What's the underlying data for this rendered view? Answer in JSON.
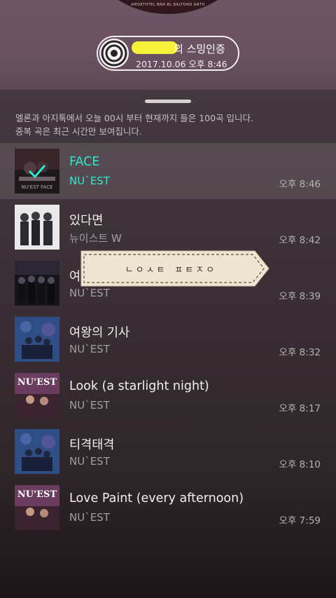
{
  "header": {
    "disc_text": "AMOKTHTEL BNA BL BALTOND ANTH",
    "badge_title": "의 스밍인증",
    "badge_time": "2017.10.06 오후 8:46"
  },
  "panel": {
    "notice_line1": "멜론과 아지톡에서 오늘 00시 부터 현재까지 들은 100곡 입니다.",
    "notice_line2": "중복 곡은 최근 시간만 보여집니다."
  },
  "songs": [
    {
      "title": "FACE",
      "artist": "NU`EST",
      "time": "오후 8:46",
      "active": true,
      "cover_text": "NU'EST FACE"
    },
    {
      "title": "있다면",
      "artist": "뉴이스트 W",
      "time": "오후 8:42",
      "active": false,
      "cover_text": ""
    },
    {
      "title": "여",
      "artist": "NU`EST",
      "time": "오후 8:39",
      "active": false,
      "cover_text": ""
    },
    {
      "title": "여왕의 기사",
      "artist": "NU`EST",
      "time": "오후 8:32",
      "active": false,
      "cover_text": ""
    },
    {
      "title": "Look (a starlight night)",
      "artist": "NU`EST",
      "time": "오후 8:17",
      "active": false,
      "cover_text": "NU'EST"
    },
    {
      "title": "티격태격",
      "artist": "NU`EST",
      "time": "오후 8:10",
      "active": false,
      "cover_text": ""
    },
    {
      "title": "Love Paint (every afternoon)",
      "artist": "NU`EST",
      "time": "오후 7:59",
      "active": false,
      "cover_text": "NU'EST"
    }
  ],
  "sticker": {
    "text": "ㄴㅇㅅㅌ ㅍㅌㅈㅇ"
  },
  "colors": {
    "accent": "#2fe6d0",
    "badge_mask": "#f6f23a",
    "sticker": "#efe5d3"
  }
}
